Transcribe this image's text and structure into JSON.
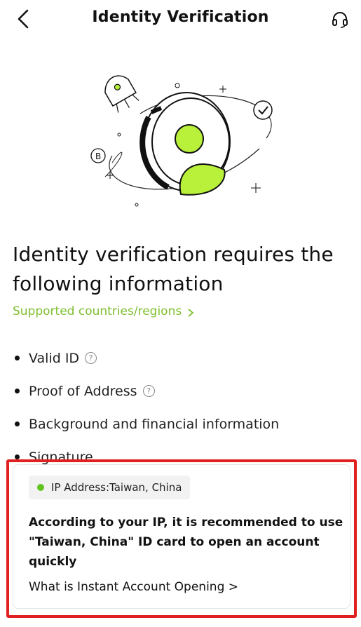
{
  "header": {
    "title": "Identity Verification",
    "back_icon": "chevron-left-icon",
    "support_icon": "headset-icon"
  },
  "illustration": {
    "icon": "identity-verification-illustration",
    "colors": {
      "accent": "#b8f03a",
      "line": "#111111"
    }
  },
  "main": {
    "heading": "Identity verification requires the following information",
    "supported_link": "Supported countries/regions",
    "link_color": "#7ebf2f",
    "requirements": [
      {
        "label": "Valid ID",
        "has_help": true
      },
      {
        "label": "Proof of Address",
        "has_help": true
      },
      {
        "label": "Background and financial information",
        "has_help": false
      },
      {
        "label": "Signature",
        "has_help": false
      }
    ]
  },
  "ip_card": {
    "ip_label": "IP Address:Taiwan, China",
    "status_color": "#61c320",
    "recommendation": "According to your IP, it is recommended to use \"Taiwan, China\" ID card to open an account quickly",
    "instant_link": "What is Instant Account Opening >"
  },
  "annotation": {
    "highlight_color": "#e02020"
  }
}
